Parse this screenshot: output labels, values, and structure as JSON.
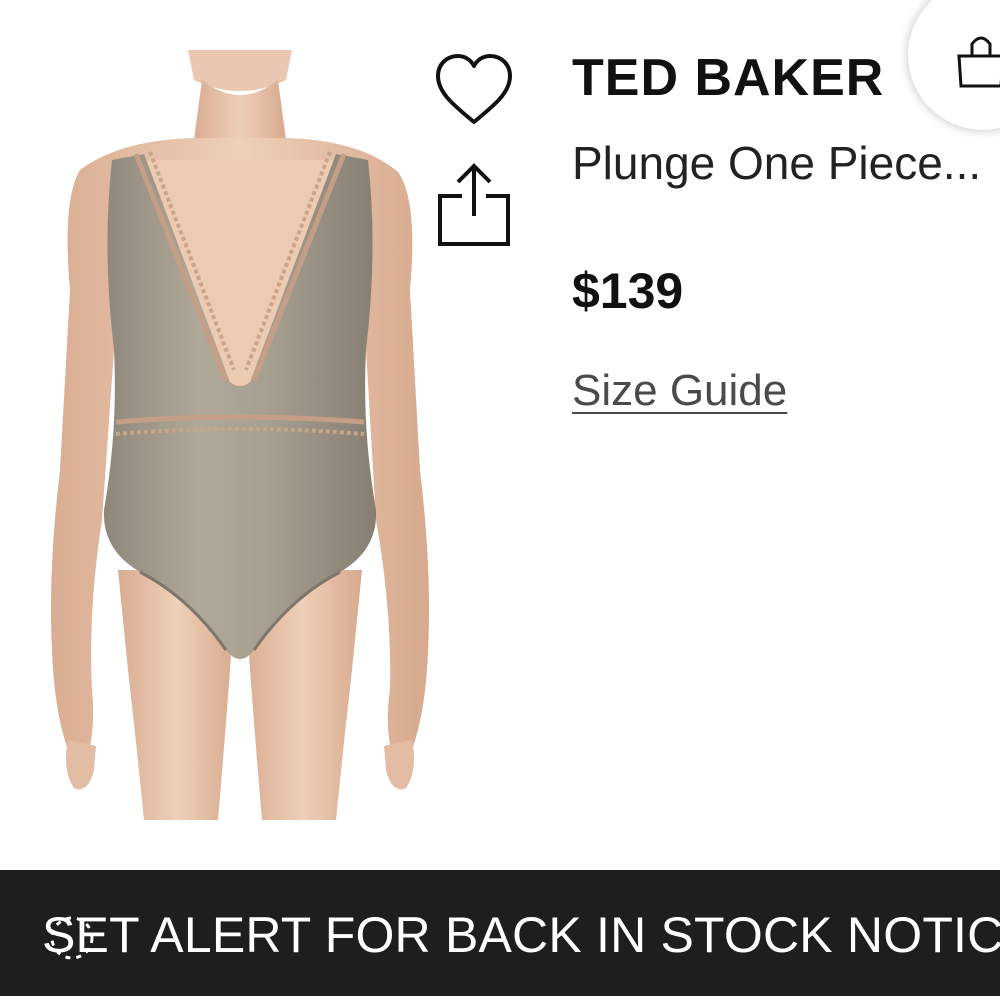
{
  "product": {
    "brand": "TED BAKER",
    "name": "Plunge One Piece...",
    "price": "$139",
    "size_guide_label": "Size Guide",
    "image_alt": "Plunge One Piece swimsuit"
  },
  "actions": {
    "alert_label": "SET ALERT FOR BACK IN STOCK NOTICE"
  },
  "icons": {
    "favorite": "heart-icon",
    "share": "share-icon",
    "bag": "shopping-bag-icon",
    "loading": "spinner-icon"
  },
  "colors": {
    "text_primary": "#111111",
    "bar_background": "#1e1e1e",
    "swimsuit": "#a39a8c",
    "skin": "#e8c5ad"
  }
}
